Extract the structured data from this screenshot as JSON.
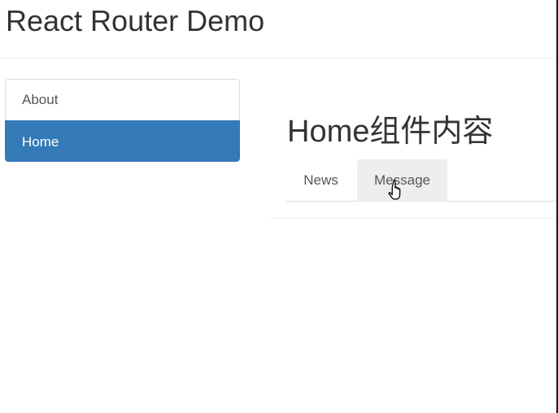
{
  "header": {
    "title": "React Router Demo"
  },
  "sidebar": {
    "items": [
      {
        "label": "About",
        "active": false
      },
      {
        "label": "Home",
        "active": true
      }
    ]
  },
  "main": {
    "heading": "Home组件内容",
    "tabs": [
      {
        "label": "News",
        "hovered": false
      },
      {
        "label": "Message",
        "hovered": true
      }
    ]
  },
  "colors": {
    "accent": "#337ab7",
    "tab_hover_bg": "#eeeeee",
    "text": "#333333"
  },
  "icons": {
    "cursor": "hand-pointer-icon"
  }
}
